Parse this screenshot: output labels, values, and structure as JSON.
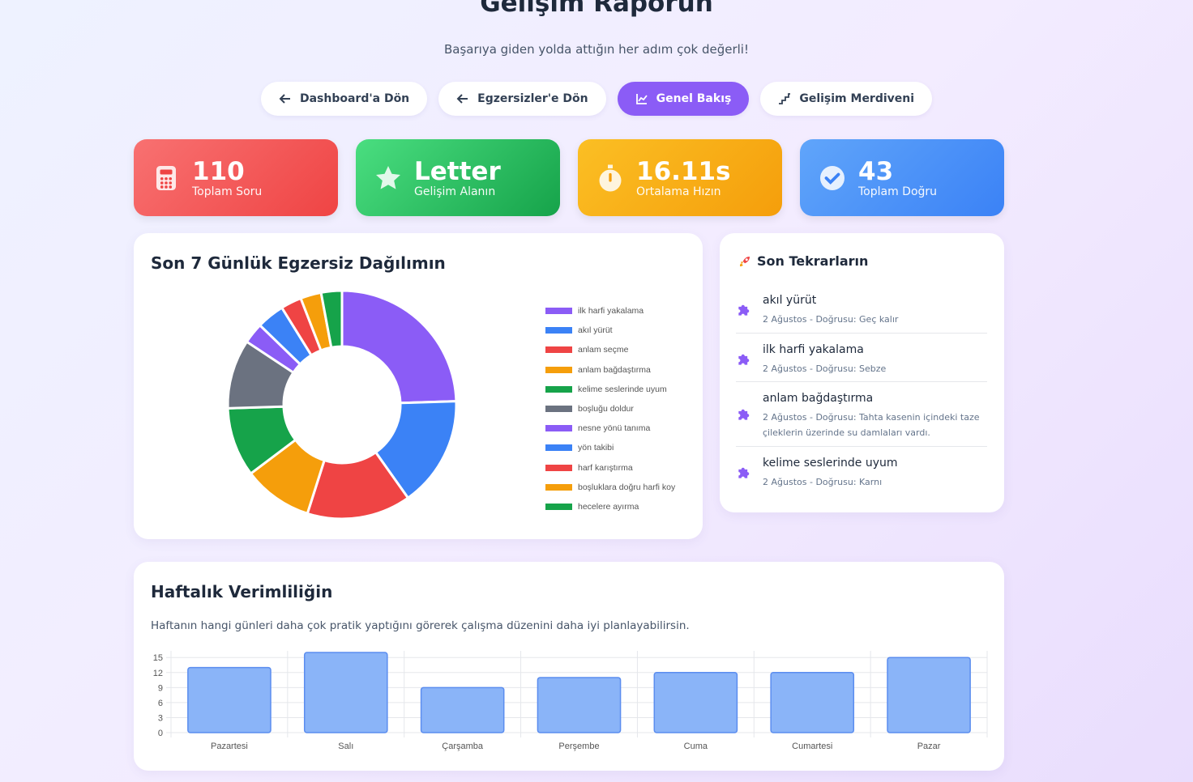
{
  "page": {
    "title": "Gelişim Raporun",
    "subtitle": "Başarıya giden yolda attığın her adım çok değerli!"
  },
  "nav": [
    {
      "label": "Dashboard'a Dön",
      "icon": "arrow-left-icon",
      "active": false
    },
    {
      "label": "Egzersizler'e Dön",
      "icon": "arrow-left-icon",
      "active": false
    },
    {
      "label": "Genel Bakış",
      "icon": "chart-line-icon",
      "active": true
    },
    {
      "label": "Gelişim Merdiveni",
      "icon": "stairs-icon",
      "active": false
    }
  ],
  "stats": [
    {
      "value": "110",
      "label": "Toplam Soru",
      "icon": "calculator-icon",
      "color": "#ef4444"
    },
    {
      "value": "Letter",
      "label": "Gelişim Alanın",
      "icon": "star-icon",
      "color": "#16a34a"
    },
    {
      "value": "16.11s",
      "label": "Ortalama Hızın",
      "icon": "stopwatch-icon",
      "color": "#f59e0b"
    },
    {
      "value": "43",
      "label": "Toplam Doğru",
      "icon": "check-circle-icon",
      "color": "#3b82f6"
    }
  ],
  "distribution": {
    "title": "Son 7 Günlük Egzersiz Dağılımın"
  },
  "tekrarlar": {
    "title": "Son Tekrarların",
    "title_icon": "rocket-icon",
    "items": [
      {
        "name": "akıl yürüt",
        "detail": "2 Ağustos - Doğrusu: Geç kalır"
      },
      {
        "name": "ilk harfi yakalama",
        "detail": "2 Ağustos - Doğrusu: Sebze"
      },
      {
        "name": "anlam bağdaştırma",
        "detail": "2 Ağustos - Doğrusu: Tahta kasenin içindeki taze çileklerin üzerinde su damlaları vardı."
      },
      {
        "name": "kelime seslerinde uyum",
        "detail": "2 Ağustos - Doğrusu: Karnı"
      }
    ]
  },
  "weekly": {
    "title": "Haftalık Verimliliğin",
    "description": "Haftanın hangi günleri daha çok pratik yaptığını görerek çalışma düzenini daha iyi planlayabilirsin."
  },
  "chart_data": [
    {
      "type": "pie",
      "variant": "doughnut",
      "legend_position": "right",
      "categories": [
        "ilk harfi yakalama",
        "akıl yürüt",
        "anlam seçme",
        "anlam bağdaştırma",
        "kelime seslerinde uyum",
        "boşluğu doldur",
        "nesne yönü tanıma",
        "yön takibi",
        "harf karıştırma",
        "boşluklara doğru harfi koy",
        "hecelere ayırma"
      ],
      "values": [
        25,
        16,
        15,
        10,
        10,
        10,
        3,
        4,
        3,
        3,
        3
      ],
      "colors": [
        "#8b5cf6",
        "#3b82f6",
        "#ef4444",
        "#f59e0b",
        "#16a34a",
        "#6b7280",
        "#8b5cf6",
        "#3b82f6",
        "#ef4444",
        "#f59e0b",
        "#16a34a"
      ]
    },
    {
      "type": "bar",
      "categories": [
        "Pazartesi",
        "Salı",
        "Çarşamba",
        "Perşembe",
        "Cuma",
        "Cumartesi",
        "Pazar"
      ],
      "values": [
        13,
        16,
        9,
        11,
        12,
        12,
        15
      ],
      "yticks": [
        0,
        3,
        6,
        9,
        12,
        15
      ],
      "ylim": [
        0,
        16
      ],
      "grid": true,
      "bar_color": "#8ab4f8",
      "bar_border": "#5b8def"
    }
  ]
}
